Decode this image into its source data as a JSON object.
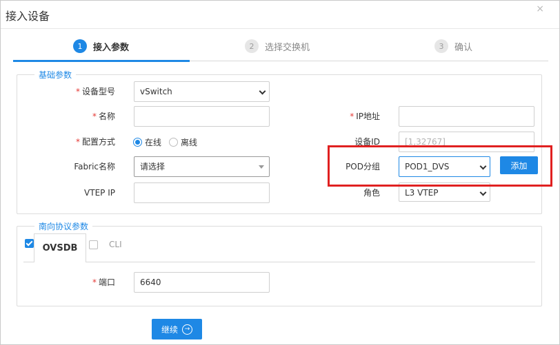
{
  "dialog": {
    "title": "接入设备",
    "close_icon": "×"
  },
  "steps": [
    {
      "num": "1",
      "label": "接入参数"
    },
    {
      "num": "2",
      "label": "选择交换机"
    },
    {
      "num": "3",
      "label": "确认"
    }
  ],
  "basic": {
    "legend": "基础参数",
    "device_model_label": "设备型号",
    "device_model_value": "vSwitch",
    "name_label": "名称",
    "name_value": "",
    "ip_label": "IP地址",
    "ip_value": "",
    "config_mode_label": "配置方式",
    "config_mode_online": "在线",
    "config_mode_offline": "离线",
    "device_id_label": "设备ID",
    "device_id_placeholder": "[1,32767]",
    "fabric_label": "Fabric名称",
    "fabric_value": "请选择",
    "pod_label": "POD分组",
    "pod_value": "POD1_DVS",
    "add_button": "添加",
    "vtep_ip_label": "VTEP IP",
    "vtep_ip_value": "",
    "role_label": "角色",
    "role_value": "L3 VTEP"
  },
  "southbound": {
    "legend": "南向协议参数",
    "tab_ovsdb": "OVSDB",
    "tab_cli": "CLI",
    "port_label": "端口",
    "port_value": "6640"
  },
  "footer": {
    "continue_label": "继续",
    "continue_icon": "→"
  },
  "colors": {
    "accent": "#1e88e5",
    "required": "#e53935",
    "highlight_box": "#e02020"
  }
}
